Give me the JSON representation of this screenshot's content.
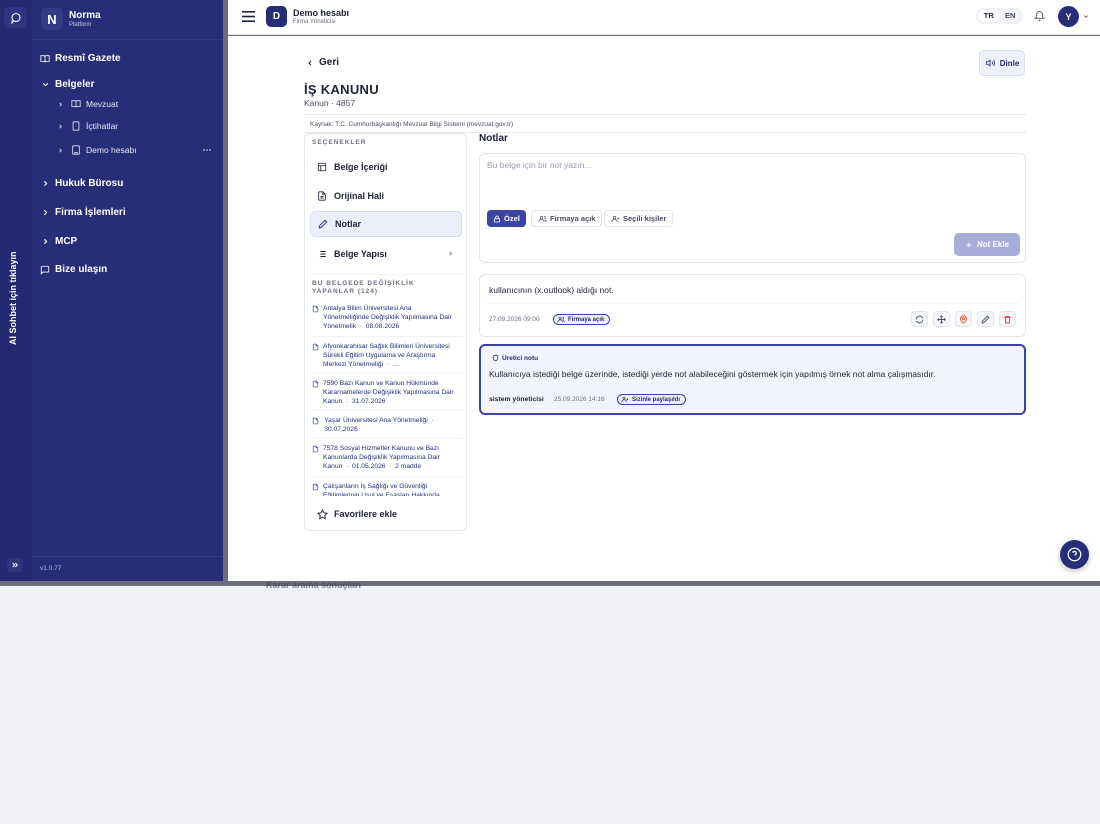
{
  "rail": {
    "vertical_label": "AI Sohbet için tıklayın"
  },
  "sidebar": {
    "brand": {
      "logo": "N",
      "name": "Norma",
      "sub": "Platform"
    },
    "items": [
      {
        "label": "Resmî Gazete",
        "icon": "book-open-icon"
      },
      {
        "label": "Belgeler",
        "icon": "chevron-down-icon"
      },
      {
        "label": "Hukuk Bürosu",
        "icon": "chevron-right-icon"
      },
      {
        "label": "Firma İşlemleri",
        "icon": "chevron-right-icon"
      },
      {
        "label": "MCP",
        "icon": "chevron-right-icon"
      },
      {
        "label": "Bize ulaşın",
        "icon": "message-square-icon"
      }
    ],
    "sub_items": [
      {
        "label": "Mevzuat",
        "icon": "book-icon"
      },
      {
        "label": "İçtihatlar",
        "icon": "tablet-icon"
      },
      {
        "label": "Demo hesabı",
        "icon": "building-icon"
      }
    ],
    "version": "v1.0.77"
  },
  "header": {
    "account_logo": "D",
    "account_name": "Demo hesabı",
    "account_role": "Firma Yöneticisi",
    "lang_tr": "TR",
    "lang_en": "EN",
    "user_initial": "Y"
  },
  "document": {
    "back_label": "Geri",
    "title": "İŞ KANUNU",
    "subtitle": "Kanun · 4857",
    "listen_label": "Dinle",
    "source": "Kaynak: T.C. Cumhurbaşkanlığı Mevzuat Bilgi Sistemi (mevzuat.gov.tr)"
  },
  "options": {
    "caption": "SEÇENEKLER",
    "items": [
      {
        "label": "Belge İçeriği"
      },
      {
        "label": "Orijinal Hali"
      },
      {
        "label": "Notlar"
      },
      {
        "label": "Belge Yapısı"
      }
    ],
    "changes_caption": "BU BELGEDE DEĞİŞİKLİK YAPANLAR (124)",
    "changes": [
      {
        "text": "Antalya Bilim Üniversitesi Ana Yönetmeliğinde Değişiklik Yapılmasına Dair Yönetmelik",
        "date": "08.08.2026"
      },
      {
        "text": "Afyonkarahisar Sağlık Bilimleri Üniversitesi Sürekli Eğitim Uygulama ve Araştırma Merkezi Yönetmeliği",
        "date": "…"
      },
      {
        "text": "7590 Bazı Kanun ve Kanun Hükmünde Kararnamelerde Değişiklik Yapılmasına Dair Kanun",
        "date": "31.07.2026"
      },
      {
        "text": "Yaşar Üniversitesi Ana Yönetmeliği",
        "date": "30.07.2026"
      },
      {
        "text": "7578 Sosyal Hizmetler Kanunu ve Bazı Kanunlarda Değişiklik Yapılmasına Dair Kanun",
        "date": "01.05.2026",
        "extra": "2 madde"
      },
      {
        "text": "Çalışanların İş Sağlığı ve Güvenliği Eğitimlerinin Usul ve Esasları Hakkında",
        "date": ""
      }
    ],
    "favorite_label": "Favorilere ekle"
  },
  "notes": {
    "title": "Notlar",
    "placeholder": "Bu belge için bir not yazın...",
    "visibility": [
      "Özel",
      "Firmaya açık",
      "Seçili kişiler"
    ],
    "add_label": "Not Ekle",
    "list": [
      {
        "body": "kullanıcının (x.outlook) aldığı not.",
        "date": "27.09.2026 09:00",
        "badge": "Firmaya açık"
      },
      {
        "tag": "Üretici notu",
        "body": "Kullanıcıya istediği belge üzerinde, istediği yerde not alabileceğini göstermek için yapılmış örnek not alma çalışmasıdır.",
        "author": "sistem yöneticisi",
        "date": "25.09.2026 14:16",
        "badge": "Sizinle paylaşıldı"
      }
    ]
  },
  "background_text": "Karar arama sonuçları",
  "colors": {
    "sidebar": "#262e77",
    "accent": "#3b44a3",
    "rail": "#232a70"
  }
}
